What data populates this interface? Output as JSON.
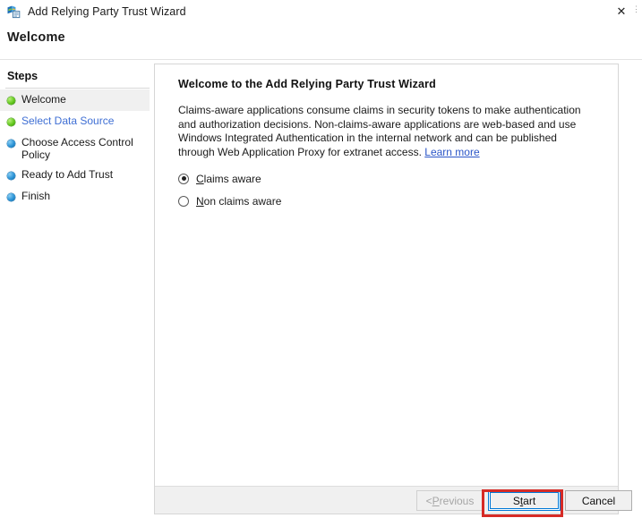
{
  "window": {
    "title": "Add Relying Party Trust Wizard",
    "icon": "wizard-shield-icon",
    "close_label": "✕",
    "overflow_label": "⋮"
  },
  "page": {
    "header_title": "Welcome"
  },
  "sidebar": {
    "title": "Steps",
    "items": [
      {
        "label": "Welcome",
        "state": "done",
        "bullet_color": "#5cb816",
        "current": true,
        "is_link": false
      },
      {
        "label": "Select Data Source",
        "state": "done",
        "bullet_color": "#5cb816",
        "current": false,
        "is_link": true
      },
      {
        "label": "Choose Access Control Policy",
        "state": "pending",
        "bullet_color": "#2b93d6",
        "current": false,
        "is_link": false
      },
      {
        "label": "Ready to Add Trust",
        "state": "pending",
        "bullet_color": "#2b93d6",
        "current": false,
        "is_link": false
      },
      {
        "label": "Finish",
        "state": "pending",
        "bullet_color": "#2b93d6",
        "current": false,
        "is_link": false
      }
    ]
  },
  "content": {
    "heading": "Welcome to the Add Relying Party Trust Wizard",
    "paragraph": "Claims-aware applications consume claims in security tokens to make authentication and authorization decisions. Non-claims-aware applications are web-based and use Windows Integrated Authentication in the internal network and can be published through Web Application Proxy for extranet access. ",
    "link_text": "Learn more",
    "link_color": "#2b56c8",
    "options": [
      {
        "label_prefix": "",
        "accelerator": "C",
        "label_rest": "laims aware",
        "selected": true
      },
      {
        "label_prefix": "",
        "accelerator": "N",
        "label_rest": "on claims aware",
        "selected": false
      }
    ]
  },
  "footer": {
    "previous_prefix": "< ",
    "previous_accelerator": "P",
    "previous_rest": "revious",
    "previous_enabled": false,
    "start_prefix": "S",
    "start_accelerator": "t",
    "start_rest": "art",
    "start_focused": true,
    "cancel_label": "Cancel"
  },
  "annotation": {
    "color": "#d62b26",
    "target": "start-button"
  }
}
